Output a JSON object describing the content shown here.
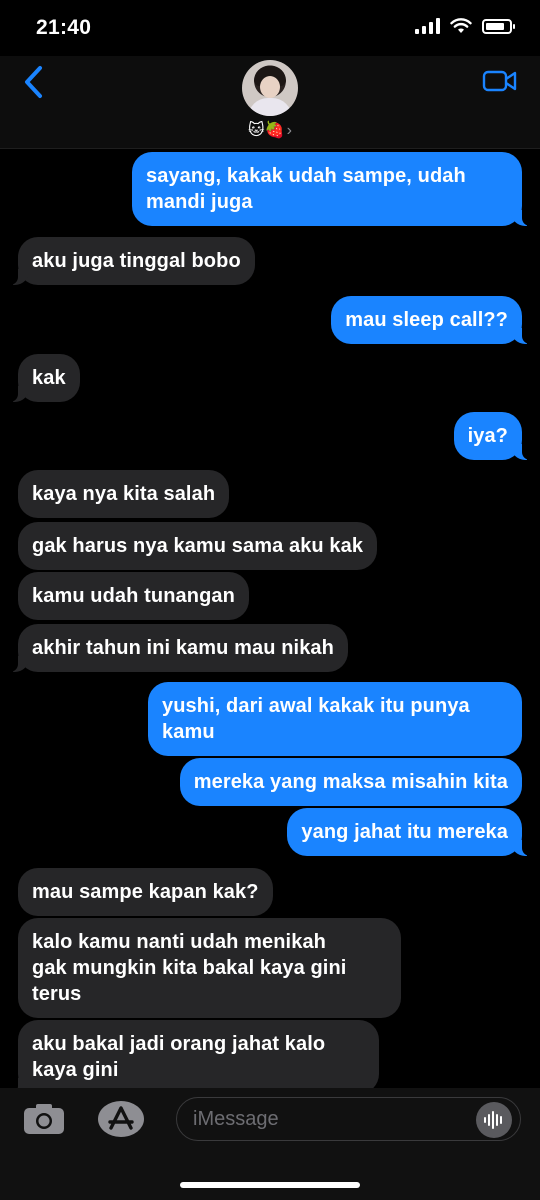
{
  "status_bar": {
    "time": "21:40"
  },
  "header": {
    "contact_name": "🐱🍓",
    "chevron": "›"
  },
  "messages": [
    {
      "from": "me",
      "text": "sayang, kakak udah sampe, udah\nmandi juga"
    },
    {
      "from": "them",
      "text": "aku juga tinggal bobo"
    },
    {
      "from": "me",
      "text": "mau sleep call??"
    },
    {
      "from": "them",
      "text": "kak"
    },
    {
      "from": "me",
      "text": "iya?"
    },
    {
      "from": "them",
      "text": "kaya nya kita salah"
    },
    {
      "from": "them",
      "text": "gak harus nya kamu sama aku kak"
    },
    {
      "from": "them",
      "text": "kamu udah tunangan"
    },
    {
      "from": "them",
      "text": "akhir tahun ini kamu mau nikah"
    },
    {
      "from": "me",
      "text": "yushi, dari awal kakak itu punya\nkamu"
    },
    {
      "from": "me",
      "text": "mereka yang maksa misahin kita"
    },
    {
      "from": "me",
      "text": "yang jahat itu mereka"
    },
    {
      "from": "them",
      "text": "mau sampe kapan kak?"
    },
    {
      "from": "them",
      "text": "kalo kamu nanti udah menikah\ngak mungkin kita bakal kaya gini\nterus"
    },
    {
      "from": "them",
      "text": "aku bakal jadi orang jahat kalo\nkaya gini"
    }
  ],
  "composer": {
    "placeholder": "iMessage"
  },
  "colors": {
    "outgoing": "#1a84ff",
    "incoming": "#262628",
    "accent": "#1a84ff",
    "background": "#000000"
  },
  "icons": [
    "back-chevron-icon",
    "video-camera-icon",
    "camera-icon",
    "app-store-icon",
    "audio-waveform-icon"
  ]
}
